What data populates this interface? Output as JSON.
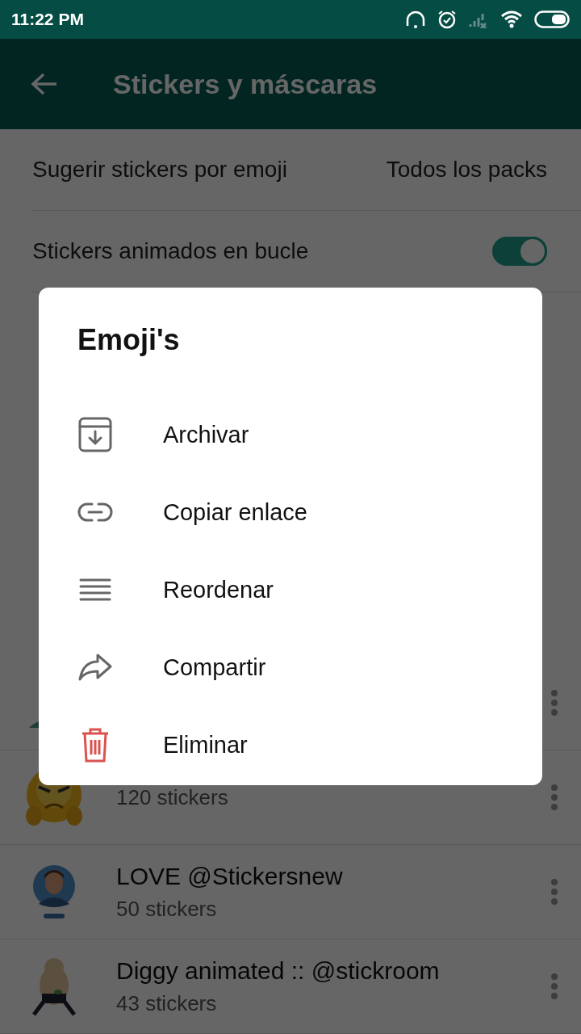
{
  "status_bar": {
    "time": "11:22 PM"
  },
  "app_bar": {
    "title": "Stickers y máscaras"
  },
  "settings": [
    {
      "kind": "value",
      "label": "Sugerir stickers por emoji",
      "value": "Todos los packs"
    },
    {
      "kind": "toggle",
      "label": "Stickers animados en bucle",
      "on": true
    }
  ],
  "packs": [
    {
      "kind": "hidden"
    },
    {
      "count": "120 stickers",
      "kind": "emoji"
    },
    {
      "name": "LOVE @Stickersnew",
      "count": "50 stickers",
      "kind": "person"
    },
    {
      "name": "Diggy animated :: @stickroom",
      "count": "43 stickers",
      "kind": "figure"
    }
  ],
  "dialog": {
    "title": "Emoji's",
    "items": [
      {
        "kind": "archive",
        "label": "Archivar"
      },
      {
        "kind": "link",
        "label": "Copiar enlace"
      },
      {
        "kind": "reorder",
        "label": "Reordenar"
      },
      {
        "kind": "share",
        "label": "Compartir"
      },
      {
        "kind": "delete",
        "label": "Eliminar"
      }
    ]
  }
}
